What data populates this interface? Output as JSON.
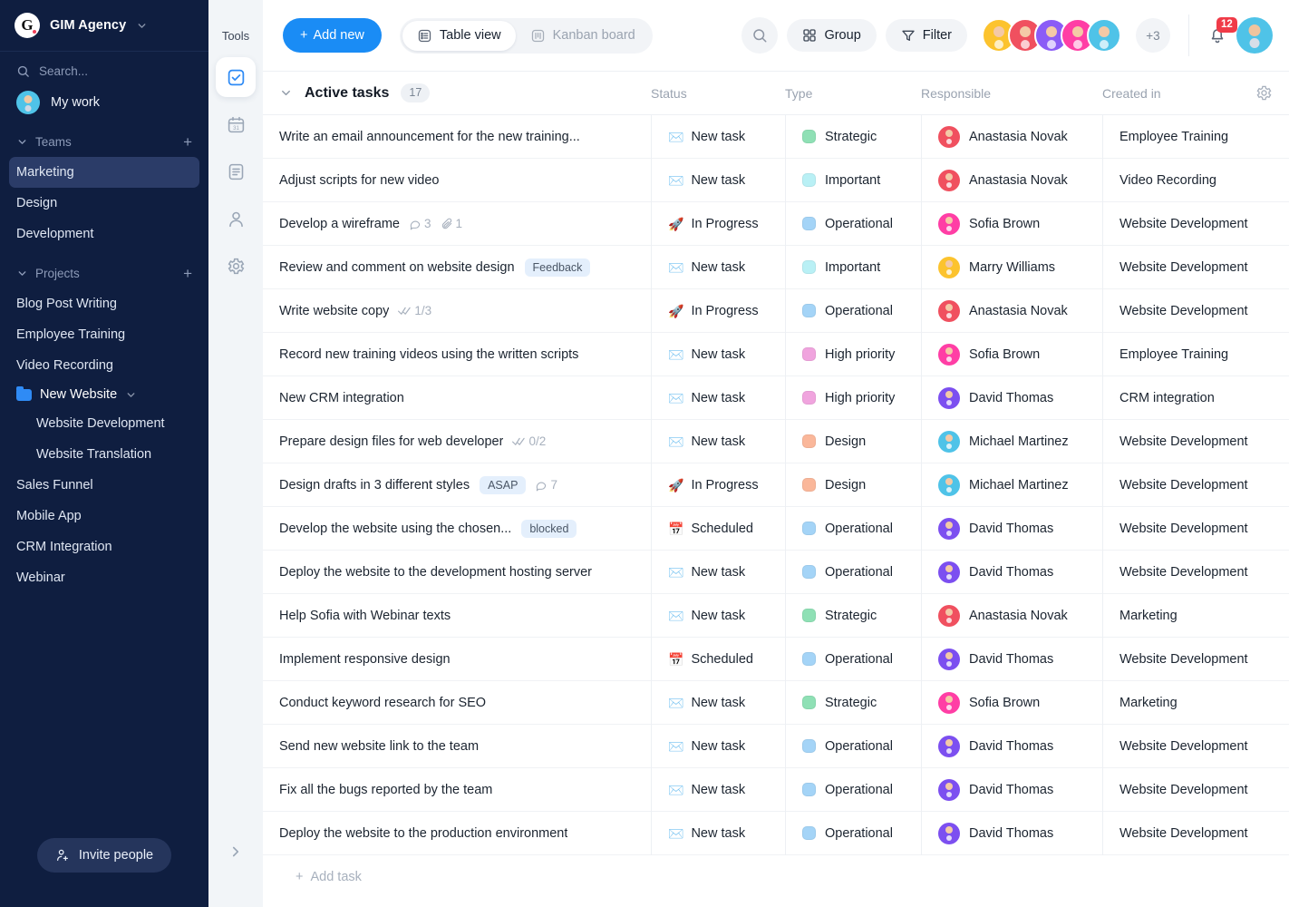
{
  "sidebar": {
    "brand": {
      "logo_letter": "G",
      "name": "GIM Agency",
      "chevron": "chevron-down"
    },
    "search": {
      "placeholder": "Search...",
      "label": "Search..."
    },
    "my_work": "My work",
    "teams": {
      "label": "Teams",
      "add": "+",
      "items": [
        {
          "label": "Marketing",
          "active": true
        },
        {
          "label": "Design",
          "active": false
        },
        {
          "label": "Development",
          "active": false
        }
      ]
    },
    "projects": {
      "label": "Projects",
      "add": "+",
      "items": [
        {
          "label": "Blog Post Writing",
          "type": "item"
        },
        {
          "label": "Employee Training",
          "type": "item"
        },
        {
          "label": "Video Recording",
          "type": "item"
        },
        {
          "label": "New Website",
          "type": "folder"
        },
        {
          "label": "Website Development",
          "type": "sub"
        },
        {
          "label": "Website Translation",
          "type": "sub"
        },
        {
          "label": "Sales Funnel",
          "type": "item"
        },
        {
          "label": "Mobile App",
          "type": "item"
        },
        {
          "label": "CRM Integration",
          "type": "item"
        },
        {
          "label": "Webinar",
          "type": "item"
        }
      ]
    },
    "invite_label": "Invite people"
  },
  "tools": {
    "title": "Tools",
    "items": [
      {
        "name": "tasks-icon",
        "active": true
      },
      {
        "name": "calendar-icon",
        "active": false
      },
      {
        "name": "document-icon",
        "active": false
      },
      {
        "name": "contacts-icon",
        "active": false
      },
      {
        "name": "settings-icon",
        "active": false
      }
    ]
  },
  "topbar": {
    "add_new": "+ Add new",
    "add_new_label": "Add new",
    "views": [
      {
        "label": "Table view",
        "icon": "table-icon",
        "active": true
      },
      {
        "label": "Kanban board",
        "icon": "kanban-icon",
        "active": false
      }
    ],
    "group_label": "Group",
    "filter_label": "Filter",
    "avatar_overflow": "+3",
    "notifications_count": "12",
    "avatar_colors": [
      "#fcc32e",
      "#f0505f",
      "#8b5cf6",
      "#ff3ea5",
      "#4fc3e8"
    ]
  },
  "table": {
    "group": {
      "title": "Active tasks",
      "count": "17",
      "collapse_icon": "chevron-down-icon"
    },
    "columns": [
      "Status",
      "Type",
      "Responsible",
      "Created in"
    ],
    "add_task": "Add task",
    "type_colors": {
      "Strategic": "#8fe0b5",
      "Important": "#b9f0f5",
      "Operational": "#a4d4f7",
      "High priority": "#f0a4de",
      "Design": "#fab79a"
    },
    "person_colors": {
      "Anastasia Novak": "#f0505f",
      "Sofia Brown": "#ff3ea5",
      "Marry Williams": "#fcc32e",
      "David Thomas": "#7c4ff0",
      "Michael Martinez": "#4fc3e8"
    },
    "status_icons": {
      "New task": "✉️",
      "In Progress": "🚀",
      "Scheduled": "📅"
    },
    "rows": [
      {
        "task": "Write an email announcement for the new training...",
        "chip": "",
        "comments": "",
        "attachments": "",
        "checks": "",
        "status": "New task",
        "type": "Strategic",
        "responsible": "Anastasia Novak",
        "created_in": "Employee Training"
      },
      {
        "task": "Adjust scripts for new video",
        "chip": "",
        "comments": "",
        "attachments": "",
        "checks": "",
        "status": "New task",
        "type": "Important",
        "responsible": "Anastasia Novak",
        "created_in": "Video Recording"
      },
      {
        "task": "Develop a wireframe",
        "chip": "",
        "comments": "3",
        "attachments": "1",
        "checks": "",
        "status": "In Progress",
        "type": "Operational",
        "responsible": "Sofia Brown",
        "created_in": "Website Development"
      },
      {
        "task": "Review and comment on website design",
        "chip": "Feedback",
        "comments": "",
        "attachments": "",
        "checks": "",
        "status": "New task",
        "type": "Important",
        "responsible": "Marry Williams",
        "created_in": "Website Development"
      },
      {
        "task": "Write website copy",
        "chip": "",
        "comments": "",
        "attachments": "",
        "checks": "1/3",
        "status": "In Progress",
        "type": "Operational",
        "responsible": "Anastasia Novak",
        "created_in": "Website Development"
      },
      {
        "task": "Record new training videos using the written scripts",
        "chip": "",
        "comments": "",
        "attachments": "",
        "checks": "",
        "status": "New task",
        "type": "High priority",
        "responsible": "Sofia Brown",
        "created_in": "Employee Training"
      },
      {
        "task": "New CRM integration",
        "chip": "",
        "comments": "",
        "attachments": "",
        "checks": "",
        "status": "New task",
        "type": "High priority",
        "responsible": "David Thomas",
        "created_in": "CRM integration"
      },
      {
        "task": "Prepare design files for web developer",
        "chip": "",
        "comments": "",
        "attachments": "",
        "checks": "0/2",
        "status": "New task",
        "type": "Design",
        "responsible": "Michael Martinez",
        "created_in": "Website Development"
      },
      {
        "task": "Design drafts in 3 different styles",
        "chip": "ASAP",
        "comments": "7",
        "attachments": "",
        "checks": "",
        "status": "In Progress",
        "type": "Design",
        "responsible": "Michael Martinez",
        "created_in": "Website Development"
      },
      {
        "task": "Develop the website using the chosen...",
        "chip": "blocked",
        "comments": "",
        "attachments": "",
        "checks": "",
        "status": "Scheduled",
        "type": "Operational",
        "responsible": "David Thomas",
        "created_in": "Website Development"
      },
      {
        "task": "Deploy the website to the development hosting server",
        "chip": "",
        "comments": "",
        "attachments": "",
        "checks": "",
        "status": "New task",
        "type": "Operational",
        "responsible": "David Thomas",
        "created_in": "Website Development"
      },
      {
        "task": "Help Sofia with Webinar texts",
        "chip": "",
        "comments": "",
        "attachments": "",
        "checks": "",
        "status": "New task",
        "type": "Strategic",
        "responsible": "Anastasia Novak",
        "created_in": "Marketing"
      },
      {
        "task": "Implement responsive design",
        "chip": "",
        "comments": "",
        "attachments": "",
        "checks": "",
        "status": "Scheduled",
        "type": "Operational",
        "responsible": "David Thomas",
        "created_in": "Website Development"
      },
      {
        "task": "Conduct keyword research for SEO",
        "chip": "",
        "comments": "",
        "attachments": "",
        "checks": "",
        "status": "New task",
        "type": "Strategic",
        "responsible": "Sofia Brown",
        "created_in": "Marketing"
      },
      {
        "task": "Send new website link to the team",
        "chip": "",
        "comments": "",
        "attachments": "",
        "checks": "",
        "status": "New task",
        "type": "Operational",
        "responsible": "David Thomas",
        "created_in": "Website Development"
      },
      {
        "task": "Fix all the bugs reported by the team",
        "chip": "",
        "comments": "",
        "attachments": "",
        "checks": "",
        "status": "New task",
        "type": "Operational",
        "responsible": "David Thomas",
        "created_in": "Website Development"
      },
      {
        "task": "Deploy the website to the production environment",
        "chip": "",
        "comments": "",
        "attachments": "",
        "checks": "",
        "status": "New task",
        "type": "Operational",
        "responsible": "David Thomas",
        "created_in": "Website Development"
      }
    ]
  }
}
